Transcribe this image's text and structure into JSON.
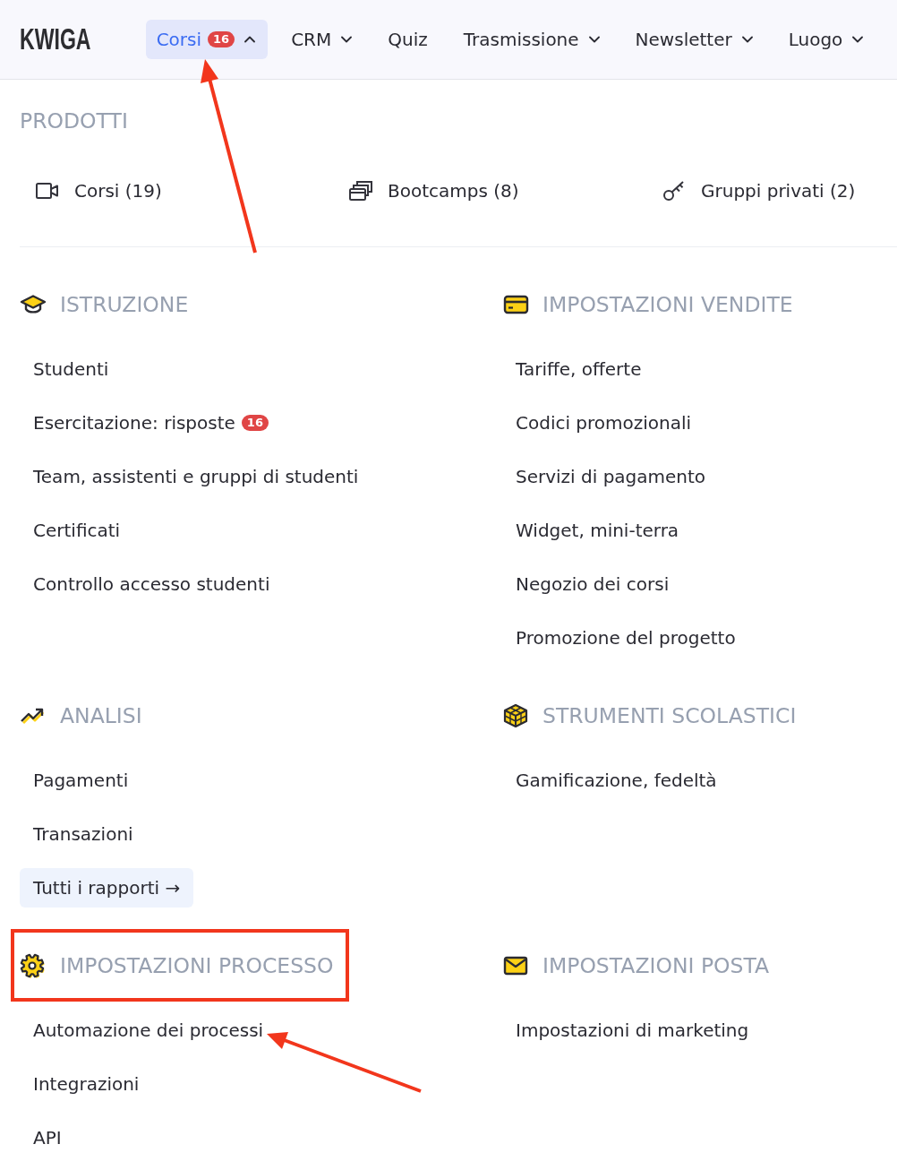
{
  "nav": {
    "logo": "KWIGA",
    "items": [
      {
        "label": "Corsi",
        "badge": "16",
        "kind": "menu",
        "selected": true,
        "expanded": true,
        "annotated": true
      },
      {
        "label": "CRM",
        "kind": "menu",
        "selected": false,
        "expanded": false,
        "annotated": false
      },
      {
        "label": "Quiz",
        "kind": "link",
        "selected": false,
        "annotated": false
      },
      {
        "label": "Trasmissione",
        "kind": "menu",
        "selected": false,
        "expanded": false,
        "annotated": false
      },
      {
        "label": "Newsletter",
        "kind": "menu",
        "selected": false,
        "expanded": false,
        "annotated": false
      },
      {
        "label": "Luogo",
        "kind": "menu",
        "selected": false,
        "expanded": false,
        "annotated": false
      }
    ]
  },
  "products": {
    "heading": "PRODOTTI",
    "items": [
      {
        "label": "Corsi (19)"
      },
      {
        "label": "Bootcamps (8)"
      },
      {
        "label": "Gruppi privati (2)"
      }
    ]
  },
  "sections": [
    {
      "title": "ISTRUZIONE",
      "highlighted": false,
      "items": [
        {
          "label": "Studenti",
          "kind": "link",
          "annotated": false
        },
        {
          "label": "Esercitazione: risposte",
          "badge": "16",
          "kind": "link",
          "annotated": false
        },
        {
          "label": "Team, assistenti e gruppi di studenti",
          "kind": "link",
          "annotated": false
        },
        {
          "label": "Certificati",
          "kind": "link",
          "annotated": false
        },
        {
          "label": "Controllo accesso studenti",
          "kind": "link",
          "annotated": false
        }
      ]
    },
    {
      "title": "IMPOSTAZIONI VENDITE",
      "highlighted": false,
      "items": [
        {
          "label": "Tariffe, offerte",
          "kind": "link",
          "annotated": false
        },
        {
          "label": "Codici promozionali",
          "kind": "link",
          "annotated": false
        },
        {
          "label": "Servizi di pagamento",
          "kind": "link",
          "annotated": false
        },
        {
          "label": "Widget, mini-terra",
          "kind": "link",
          "annotated": false
        },
        {
          "label": "Negozio dei corsi",
          "kind": "link",
          "annotated": false
        },
        {
          "label": "Promozione del progetto",
          "kind": "link",
          "annotated": false
        }
      ]
    },
    {
      "title": "ANALISI",
      "highlighted": false,
      "items": [
        {
          "label": "Pagamenti",
          "kind": "link",
          "annotated": false
        },
        {
          "label": "Transazioni",
          "kind": "link",
          "annotated": false
        },
        {
          "label": "Tutti i rapporti →",
          "kind": "button",
          "annotated": false
        }
      ]
    },
    {
      "title": "STRUMENTI SCOLASTICI",
      "highlighted": false,
      "items": [
        {
          "label": "Gamificazione, fedeltà",
          "kind": "link",
          "annotated": false
        }
      ]
    },
    {
      "title": "IMPOSTAZIONI PROCESSO",
      "highlighted": true,
      "items": [
        {
          "label": "Automazione dei processi",
          "kind": "link",
          "annotated": true
        },
        {
          "label": "Integrazioni",
          "kind": "link",
          "annotated": false
        },
        {
          "label": "API",
          "kind": "link",
          "annotated": false
        }
      ]
    },
    {
      "title": "IMPOSTAZIONI POSTA",
      "highlighted": false,
      "items": [
        {
          "label": "Impostazioni di marketing",
          "kind": "link",
          "annotated": false
        }
      ]
    }
  ]
}
